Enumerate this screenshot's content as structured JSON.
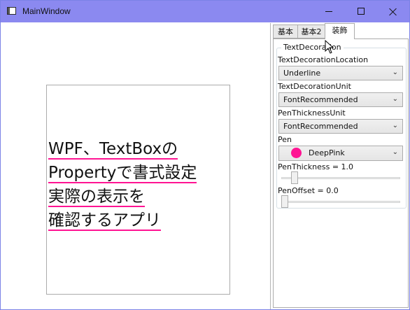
{
  "window": {
    "title": "MainWindow"
  },
  "preview": {
    "lines": [
      "WPF、TextBoxの",
      "Propertyで書式設定",
      "実際の表示を",
      "確認するアプリ"
    ],
    "decoration_color": "#ff1493"
  },
  "tabs": [
    {
      "label": "基本"
    },
    {
      "label": "基本2"
    },
    {
      "label": "装飾"
    }
  ],
  "group": {
    "title": "TextDecoration",
    "location_label": "TextDecorationLocation",
    "location_value": "Underline",
    "unit_label": "TextDecorationUnit",
    "unit_value": "FontRecommended",
    "pen_unit_label": "PenThicknessUnit",
    "pen_unit_value": "FontRecommended",
    "pen_label": "Pen",
    "pen_value": "DeepPink",
    "pen_color": "#ff1493",
    "thickness_label": "PenThickness = 1.0",
    "thickness_value": 1.0,
    "offset_label": "PenOffset = 0.0",
    "offset_value": 0.0
  }
}
